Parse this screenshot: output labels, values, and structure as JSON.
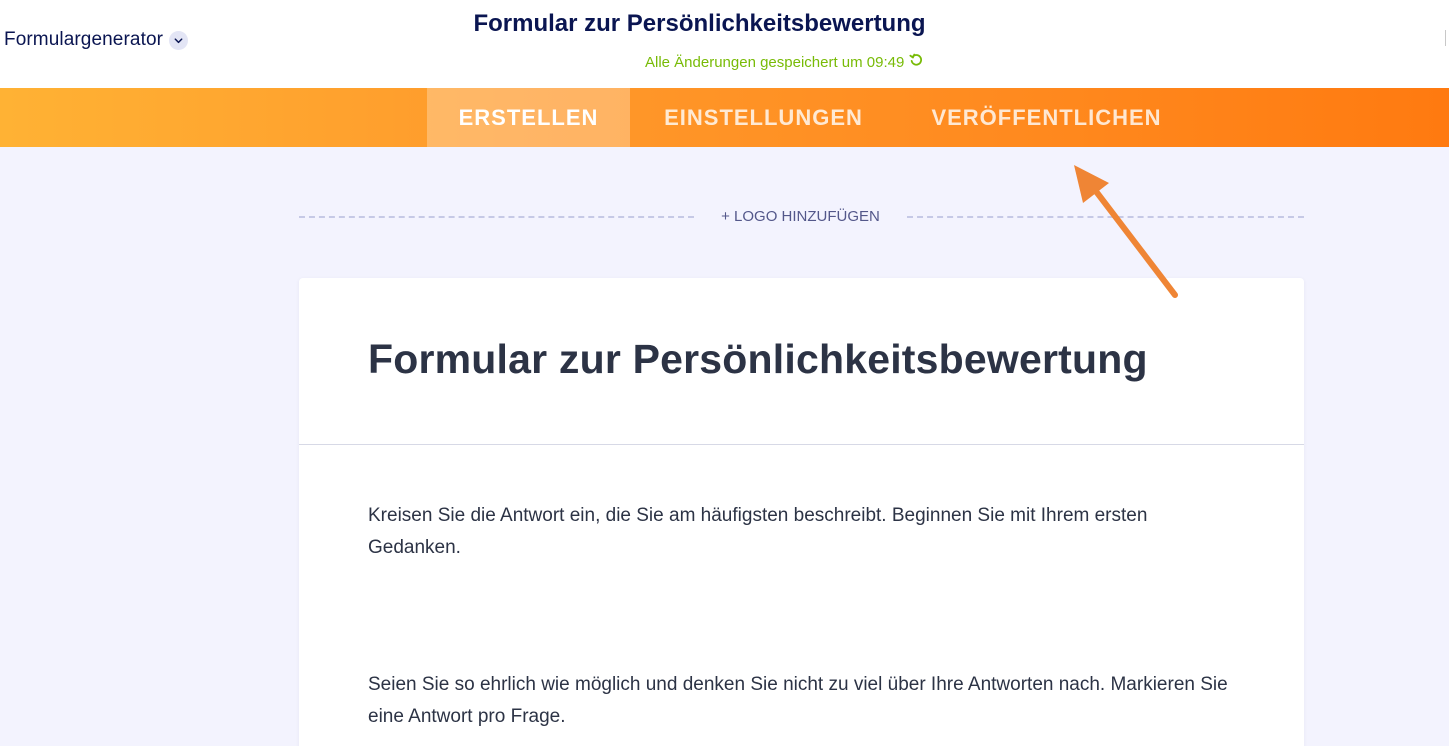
{
  "header": {
    "app_name": "Formulargenerator",
    "form_title": "Formular zur Persönlichkeitsbewertung",
    "saved_status": "Alle Änderungen gespeichert um 09:49"
  },
  "nav": {
    "tabs": [
      {
        "label": "ERSTELLEN",
        "active": true
      },
      {
        "label": "EINSTELLUNGEN",
        "active": false
      },
      {
        "label": "VERÖFFENTLICHEN",
        "active": false
      }
    ]
  },
  "builder": {
    "add_logo_label": "+ LOGO HINZUFÜGEN"
  },
  "form": {
    "heading": "Formular zur Persönlichkeitsbewertung",
    "paragraphs": [
      "Kreisen Sie die Antwort ein, die Sie am häufigsten beschreibt. Beginnen Sie mit Ihrem ersten Gedanken.",
      "Seien Sie so ehrlich wie möglich und denken Sie nicht zu viel über Ihre Antworten nach. Markieren Sie eine Antwort pro Frage."
    ]
  },
  "colors": {
    "nav_gradient_start": "#ffb234",
    "nav_gradient_end": "#ff7a10",
    "title_color": "#0a1551",
    "saved_status_color": "#78bb07",
    "annotation_arrow": "#ef8535",
    "canvas_background": "#f3f3fe"
  },
  "icons": {
    "app_switch": "chevron-down-icon",
    "saved_status": "refresh-icon"
  }
}
